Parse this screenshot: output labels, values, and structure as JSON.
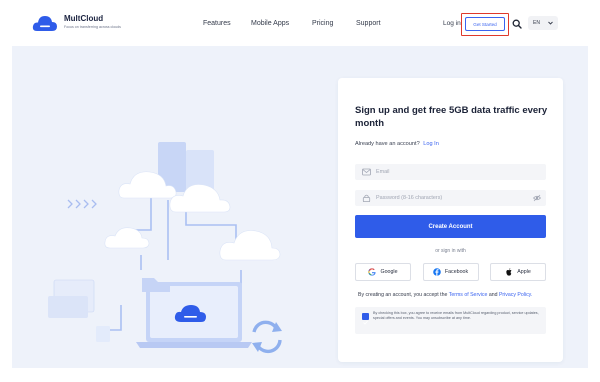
{
  "header": {
    "brand_name": "MultCloud",
    "brand_tagline": "Focus on transferring across clouds",
    "nav": [
      "Features",
      "Mobile Apps",
      "Pricing",
      "Support"
    ],
    "login_label": "Log in",
    "get_started_label": "Get Started",
    "language": "EN",
    "icons": {
      "logo": "cloud-logo-icon",
      "search": "search-icon",
      "chevron": "chevron-down-icon"
    },
    "colors": {
      "accent": "#3b64f0",
      "highlight": "#e0392b"
    }
  },
  "illustration": {
    "icons": [
      "cloud-icon",
      "laptop-icon",
      "folder-icon",
      "sync-icon",
      "arrows-icon"
    ]
  },
  "signup": {
    "title": "Sign up and get free 5GB data traffic every month",
    "have_account_text": "Already have an account?",
    "login_link": "Log In",
    "email_placeholder": "Email",
    "password_placeholder": "Password (8-16 characters)",
    "create_button": "Create Account",
    "or_text": "or sign in with",
    "social": [
      {
        "label": "Google",
        "icon": "google-icon"
      },
      {
        "label": "Facebook",
        "icon": "facebook-icon"
      },
      {
        "label": "Apple",
        "icon": "apple-icon"
      }
    ],
    "terms_prefix": "By creating an account, you accept the",
    "terms_link": "Terms of Service",
    "terms_and": "and",
    "privacy_link": "Privacy Policy.",
    "consent_checked": true,
    "consent_text": "By checking this box, you agree to receive emails from MultCloud regarding product, service updates, special offers and events. You may unsubscribe at any time.",
    "colors": {
      "primary": "#2f5ce9"
    }
  }
}
